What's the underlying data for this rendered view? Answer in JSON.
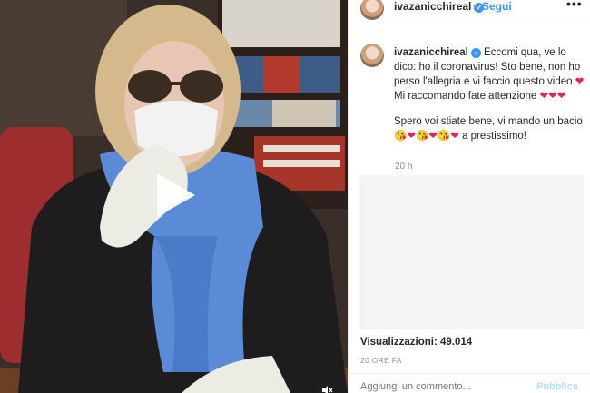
{
  "video": {
    "play_icon": "play-icon",
    "sound_icon": "speaker-muted-icon"
  },
  "header": {
    "username": "ivazanicchireal",
    "separator": "•",
    "follow_label": "Segui",
    "more_label": "•••"
  },
  "caption": {
    "username": "ivazanicchireal",
    "line1_text": "Eccomi qua, ve lo dico: ho il coronavirus! Sto bene, non ho perso l'allegria e vi faccio questo video ",
    "line1_tail": " Mi raccomando fate attenzione ",
    "hearts_1": "❤",
    "hearts_3": "❤❤❤",
    "p2_text": "Spero voi stiate bene, vi mando un bacio ",
    "p2_emojis": "😘❤😘❤😘❤",
    "p2_tail": " a prestissimo!",
    "time": "20 h"
  },
  "stats": {
    "views_label": "Visualizzazioni:",
    "views_value": "49.014",
    "date": "20 ORE FA"
  },
  "comment": {
    "placeholder": "Aggiungi un commento...",
    "publish_label": "Pubblica"
  },
  "colors": {
    "accent": "#3897f0",
    "heart": "#e0245e"
  }
}
